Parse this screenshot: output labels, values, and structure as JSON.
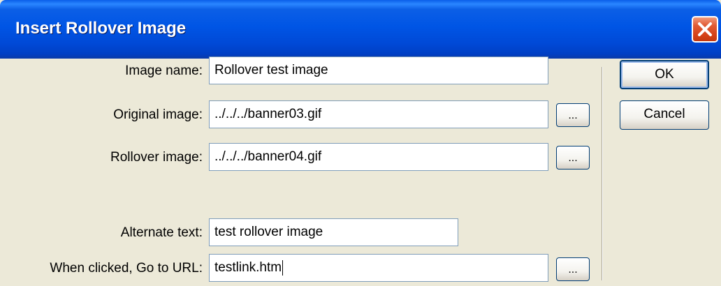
{
  "window": {
    "title": "Insert Rollover Image"
  },
  "form": {
    "image_name": {
      "label": "Image name:",
      "value": "Rollover test image"
    },
    "original_image": {
      "label": "Original image:",
      "value": "../../../banner03.gif",
      "browse_label": "..."
    },
    "rollover_image": {
      "label": "Rollover image:",
      "value": "../../../banner04.gif",
      "browse_label": "..."
    },
    "alternate_text": {
      "label": "Alternate text:",
      "value": "test rollover image"
    },
    "go_to_url": {
      "label": "When clicked, Go to URL:",
      "value": "testlink.htm",
      "browse_label": "..."
    }
  },
  "buttons": {
    "ok_label": "OK",
    "cancel_label": "Cancel"
  },
  "colors": {
    "titlebar": "#0055e5",
    "dialog_background": "#ece9d8",
    "close_button": "#d54117",
    "field_border": "#7f9db9",
    "button_border": "#003c74"
  },
  "icons": {
    "close": "close-icon"
  }
}
